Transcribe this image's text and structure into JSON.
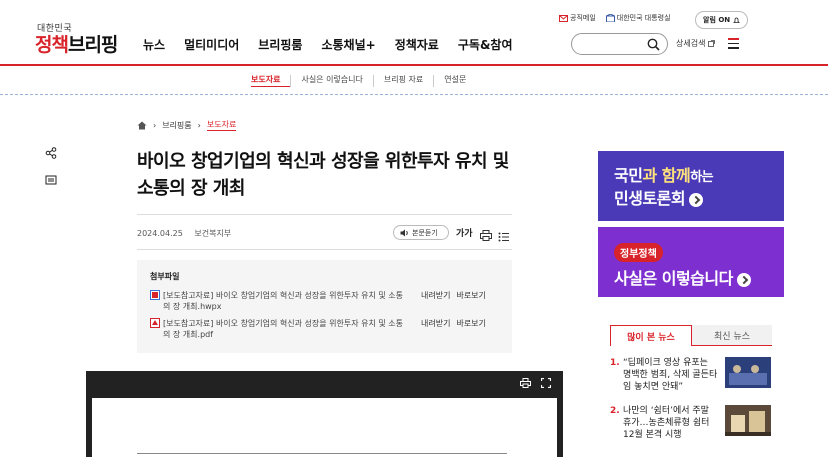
{
  "header": {
    "logo_small": "대한민국",
    "logo_big_red": "정책",
    "logo_big_black": "브리핑",
    "gnb": [
      "뉴스",
      "멀티미디어",
      "브리핑룸",
      "소통채널+",
      "정책자료",
      "구독&참여"
    ],
    "top_links": [
      "공직메일",
      "대한민국 대통령실"
    ],
    "alarm": "알림 ON",
    "search_placeholder": "",
    "detail_search": "상세검색"
  },
  "subnav": [
    "보도자료",
    "사실은 이렇습니다",
    "브리핑 자료",
    "연설문"
  ],
  "breadcrumb": [
    "브리핑룸",
    "보도자료"
  ],
  "article": {
    "title": "바이오 창업기업의 혁신과 성장을 위한투자 유치 및 소통의 장 개최",
    "date": "2024.04.25",
    "department": "보건복지부",
    "listen": "본문듣기",
    "font_size": "가가"
  },
  "attachments": {
    "heading": "첨부파일",
    "files": [
      {
        "name": "[보도참고자료] 바이오 창업기업의 혁신과 성장을 위한투자 유치 및 소통의 장 개최.hwpx",
        "download": "내려받기",
        "view": "바로보기"
      },
      {
        "name": "[보도참고자료] 바이오 창업기업의 혁신과 성장을 위한투자 유치 및 소통의 장 개최.pdf",
        "download": "내려받기",
        "view": "바로보기"
      }
    ]
  },
  "banners": {
    "b1_line1_white": "국민",
    "b1_line1_yellow": "과 함께",
    "b1_line1_rest": "하는",
    "b1_line2": "민생토론회",
    "b2_pill": "정부정책",
    "b2_text": "사실은 이렇습니다"
  },
  "news": {
    "tabs": [
      "많이 본 뉴스",
      "최신 뉴스"
    ],
    "items": [
      {
        "num": "1.",
        "text": "“딥페이크 영상 유포는 명백한 범죄, 삭제 골든타임 놓치면 안돼”"
      },
      {
        "num": "2.",
        "text": "나만의 ‘쉼터’에서 주말 휴가…농촌체류형 쉼터 12월 본격 시행"
      }
    ]
  },
  "colors": {
    "accent": "#d8232a",
    "banner1": "#4a3ab7",
    "banner2": "#7e2fcf"
  }
}
